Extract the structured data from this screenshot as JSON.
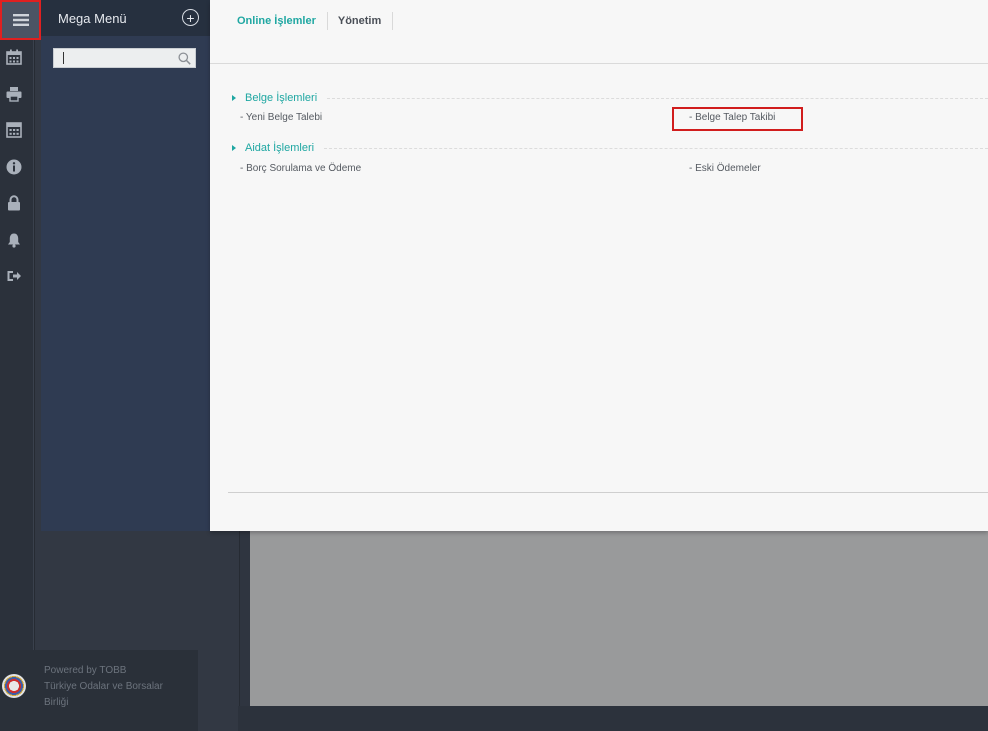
{
  "mega_menu": {
    "title": "Mega Menü",
    "add_symbol": "+",
    "search": {
      "value": "",
      "placeholder": ""
    }
  },
  "rail_icons": [
    "menu-icon",
    "calendar-icon",
    "print-icon",
    "calculator-icon",
    "info-icon",
    "lock-icon",
    "bell-icon",
    "logout-icon"
  ],
  "tabs": [
    {
      "label": "Online İşlemler",
      "active": true
    },
    {
      "label": "Yönetim",
      "active": false
    }
  ],
  "sections": [
    {
      "title": "Belge İşlemleri",
      "links": [
        "- Yeni Belge Talebi",
        "- Belge Talep Takibi"
      ]
    },
    {
      "title": "Aidat İşlemleri",
      "links": [
        "- Borç Sorulama ve Ödeme",
        "- Eski Ödemeler"
      ]
    }
  ],
  "footer": {
    "line1": "Powered by TOBB",
    "line2": "Türkiye Odalar ve Borsalar",
    "line3": "Birliği"
  },
  "colors": {
    "accent": "#1fa7a2",
    "highlight": "#d11d1d",
    "panel": "#2f3b52"
  }
}
